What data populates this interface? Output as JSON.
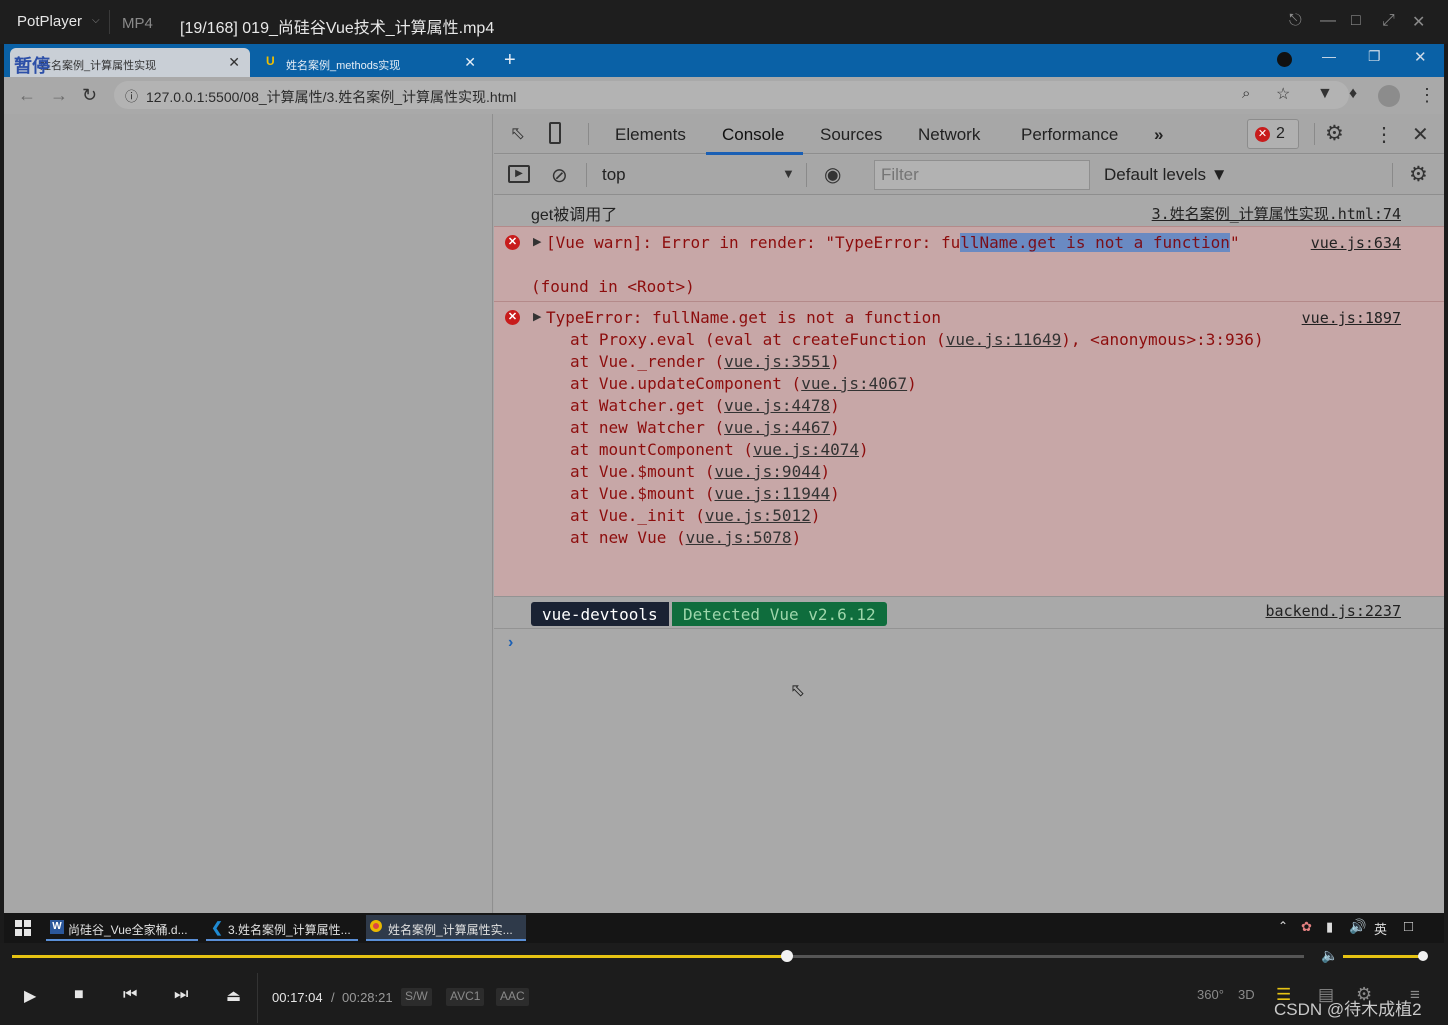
{
  "player": {
    "brand": "PotPlayer",
    "format": "MP4",
    "title": "[19/168] 019_尚硅谷Vue技术_计算属性.mp4",
    "time_current": "00:17:04",
    "time_separator": "/",
    "time_total": "00:28:21",
    "tags": [
      "S/W",
      "AVC1",
      "AAC"
    ],
    "right_icons": [
      "360°",
      "3D"
    ],
    "progress_fraction": 0.6,
    "volume_fraction": 0.98,
    "watermark": "CSDN @待木成植2",
    "accent_color": "#e6c313"
  },
  "browser": {
    "tabs": [
      {
        "label": "姓名案例_计算属性实现",
        "active": true
      },
      {
        "label": "姓名案例_methods实现",
        "active": false
      }
    ],
    "pause_label": "暂停",
    "url": "127.0.0.1:5500/08_计算属性/3.姓名案例_计算属性实现.html"
  },
  "devtools": {
    "tabs": [
      "Elements",
      "Console",
      "Sources",
      "Network",
      "Performance"
    ],
    "active_tab": "Console",
    "error_count": "2",
    "context": "top",
    "filter_placeholder": "Filter",
    "levels": "Default levels",
    "console": {
      "log1": {
        "text": "get被调用了",
        "source": "3.姓名案例_计算属性实现.html:74"
      },
      "warn": {
        "prefix": "[Vue warn]: Error in render: \"TypeError: fu",
        "highlight": "llName.get is not a function",
        "suffix": "\"",
        "found": "(found in <Root>)",
        "source": "vue.js:634"
      },
      "error": {
        "head": "TypeError: fullName.get is not a function",
        "source": "vue.js:1897",
        "stack": [
          {
            "pre": "at Proxy.eval (eval at createFunction (",
            "link": "vue.js:11649",
            "post": "), <anonymous>:3:936)"
          },
          {
            "pre": "at Vue._render (",
            "link": "vue.js:3551",
            "post": ")"
          },
          {
            "pre": "at Vue.updateComponent (",
            "link": "vue.js:4067",
            "post": ")"
          },
          {
            "pre": "at Watcher.get (",
            "link": "vue.js:4478",
            "post": ")"
          },
          {
            "pre": "at new Watcher (",
            "link": "vue.js:4467",
            "post": ")"
          },
          {
            "pre": "at mountComponent (",
            "link": "vue.js:4074",
            "post": ")"
          },
          {
            "pre": "at Vue.$mount (",
            "link": "vue.js:9044",
            "post": ")"
          },
          {
            "pre": "at Vue.$mount (",
            "link": "vue.js:11944",
            "post": ")"
          },
          {
            "pre": "at Vue._init (",
            "link": "vue.js:5012",
            "post": ")"
          },
          {
            "pre": "at new Vue (",
            "link": "vue.js:5078",
            "post": ")"
          }
        ]
      },
      "devtools_badge": {
        "left": "vue-devtools",
        "right": "Detected Vue v2.6.12",
        "source": "backend.js:2237"
      }
    }
  },
  "taskbar": {
    "items": [
      {
        "label": "尚硅谷_Vue全家桶.d...",
        "icon": "word-icon",
        "color": "#2b579a"
      },
      {
        "label": "3.姓名案例_计算属性...",
        "icon": "vscode-icon",
        "color": "#1f8ad2"
      },
      {
        "label": "姓名案例_计算属性实...",
        "icon": "chrome-icon",
        "color": "#2a2a2a"
      }
    ],
    "ime": "英"
  }
}
